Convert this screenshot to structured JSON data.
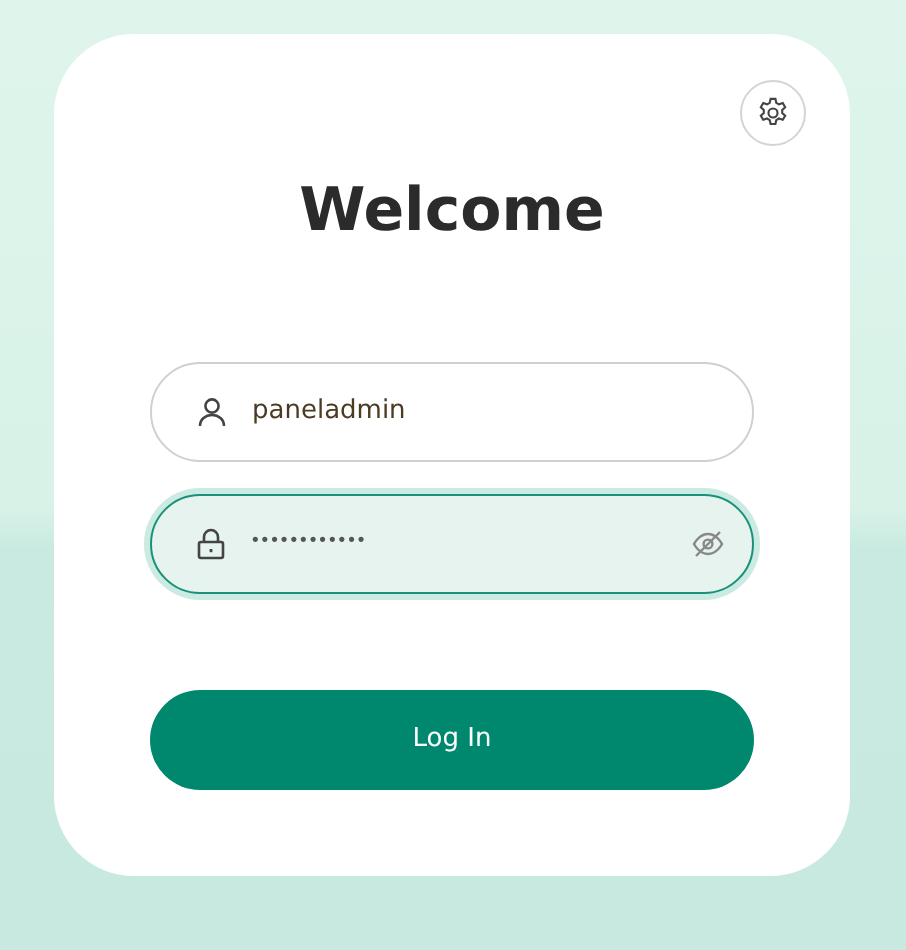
{
  "title": "Welcome",
  "fields": [
    {
      "kind": "username",
      "value": "paneladmin",
      "focused": false
    },
    {
      "kind": "password",
      "value": "••••••••••••",
      "focused": true,
      "revealed": false
    }
  ],
  "buttons": [
    {
      "label": "Log In"
    }
  ]
}
